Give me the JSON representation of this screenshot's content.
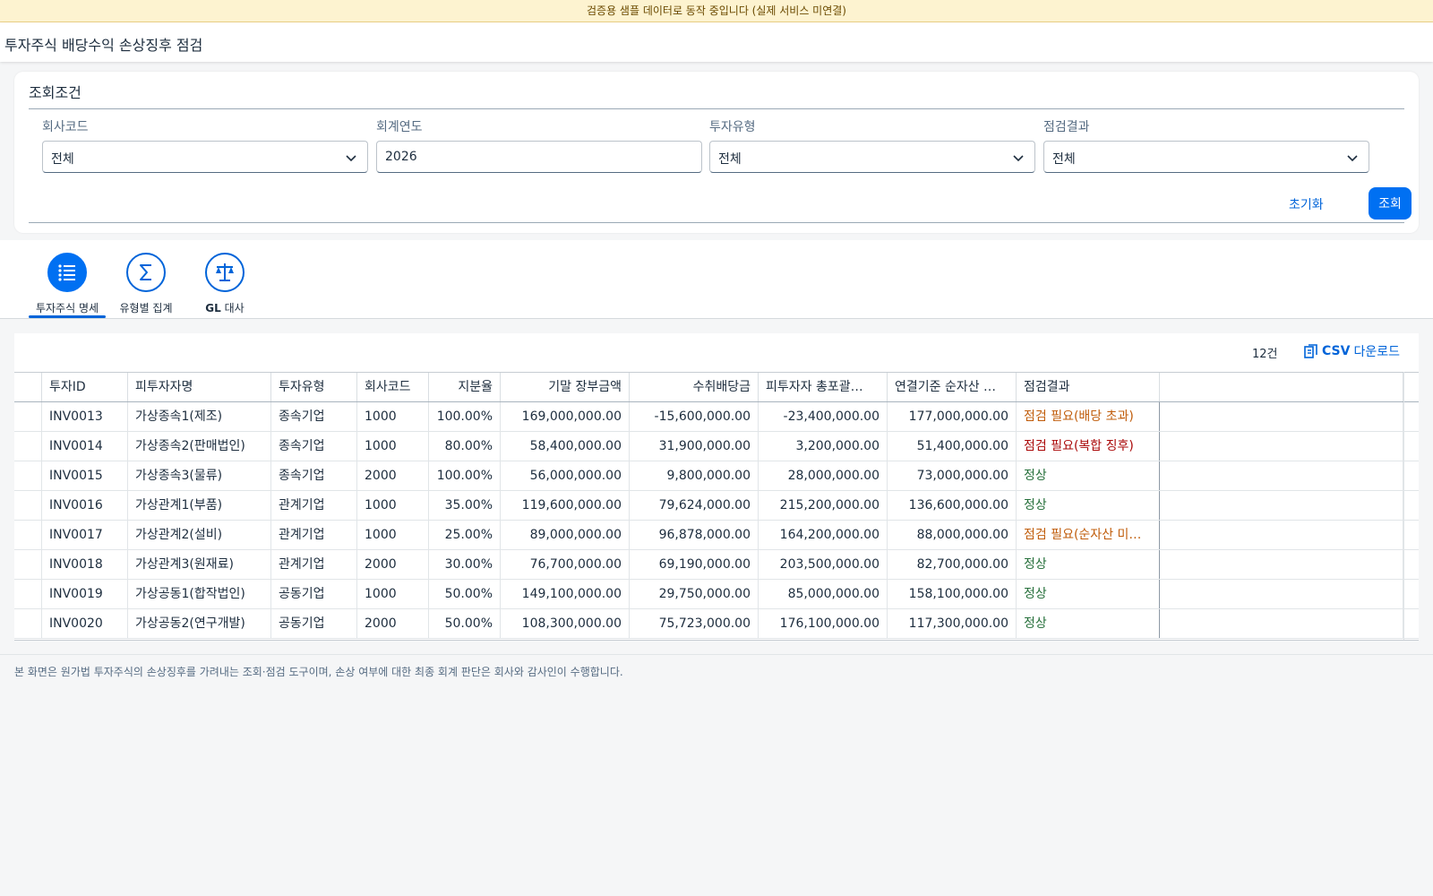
{
  "banner": "검증용 샘플 데이터로 동작 중입니다 (실제 서비스 미연결)",
  "page_title": "투자주식 배당수익 손상징후 점검",
  "filters": {
    "title": "조회조건",
    "company_label": "회사코드",
    "company_value": "전체",
    "year_label": "회계연도",
    "year_value": "2026",
    "type_label": "투자유형",
    "type_value": "전체",
    "result_label": "점검결과",
    "result_value": "전체",
    "reset_label": "초기화",
    "search_label": "조회"
  },
  "tabs": [
    {
      "label": "투자주식 명세",
      "icon": "list-icon",
      "active": true
    },
    {
      "label": "유형별 집계",
      "icon": "sigma-icon",
      "active": false
    },
    {
      "label": "대사",
      "label_strong": "GL",
      "icon": "scale-icon",
      "active": false
    }
  ],
  "table": {
    "count": "12건",
    "csv_strong": "CSV",
    "csv_label": "다운로드",
    "columns": [
      "투자ID",
      "피투자자명",
      "투자유형",
      "회사코드",
      "지분율",
      "기말 장부금액",
      "수취배당금",
      "피투자자 총포괄…",
      "연결기준 순자산 …",
      "점검결과"
    ],
    "rows": [
      {
        "id": "INV0013",
        "name": "가상종속1(제조)",
        "type": "종속기업",
        "company": "1000",
        "share": "100.00%",
        "book": "169,000,000.00",
        "dividend": "-15,600,000.00",
        "oci": "-23,400,000.00",
        "net_assets": "177,000,000.00",
        "result": "점검 필요(배당 초과)",
        "status": "warn"
      },
      {
        "id": "INV0014",
        "name": "가상종속2(판매법인)",
        "type": "종속기업",
        "company": "1000",
        "share": "80.00%",
        "book": "58,400,000.00",
        "dividend": "31,900,000.00",
        "oci": "3,200,000.00",
        "net_assets": "51,400,000.00",
        "result": "점검 필요(복합 징후)",
        "status": "err"
      },
      {
        "id": "INV0015",
        "name": "가상종속3(물류)",
        "type": "종속기업",
        "company": "2000",
        "share": "100.00%",
        "book": "56,000,000.00",
        "dividend": "9,800,000.00",
        "oci": "28,000,000.00",
        "net_assets": "73,000,000.00",
        "result": "정상",
        "status": "ok"
      },
      {
        "id": "INV0016",
        "name": "가상관계1(부품)",
        "type": "관계기업",
        "company": "1000",
        "share": "35.00%",
        "book": "119,600,000.00",
        "dividend": "79,624,000.00",
        "oci": "215,200,000.00",
        "net_assets": "136,600,000.00",
        "result": "정상",
        "status": "ok"
      },
      {
        "id": "INV0017",
        "name": "가상관계2(설비)",
        "type": "관계기업",
        "company": "1000",
        "share": "25.00%",
        "book": "89,000,000.00",
        "dividend": "96,878,000.00",
        "oci": "164,200,000.00",
        "net_assets": "88,000,000.00",
        "result": "점검 필요(순자산 미…",
        "status": "warn"
      },
      {
        "id": "INV0018",
        "name": "가상관계3(원재료)",
        "type": "관계기업",
        "company": "2000",
        "share": "30.00%",
        "book": "76,700,000.00",
        "dividend": "69,190,000.00",
        "oci": "203,500,000.00",
        "net_assets": "82,700,000.00",
        "result": "정상",
        "status": "ok"
      },
      {
        "id": "INV0019",
        "name": "가상공동1(합작법인)",
        "type": "공동기업",
        "company": "1000",
        "share": "50.00%",
        "book": "149,100,000.00",
        "dividend": "29,750,000.00",
        "oci": "85,000,000.00",
        "net_assets": "158,100,000.00",
        "result": "정상",
        "status": "ok"
      },
      {
        "id": "INV0020",
        "name": "가상공동2(연구개발)",
        "type": "공동기업",
        "company": "2000",
        "share": "50.00%",
        "book": "108,300,000.00",
        "dividend": "75,723,000.00",
        "oci": "176,100,000.00",
        "net_assets": "117,300,000.00",
        "result": "정상",
        "status": "ok"
      }
    ]
  },
  "footnote": "본 화면은 원가법 투자주식의 손상징후를 가려내는 조회·점검 도구이며, 손상 여부에 대한 최종 회계 판단은 회사와 감사인이 수행합니다.",
  "colors": {
    "accent": "#0070f2",
    "warn": "#c05c0a",
    "error": "#aa0808",
    "ok": "#256f3a",
    "banner_bg": "#fdf3d0"
  }
}
